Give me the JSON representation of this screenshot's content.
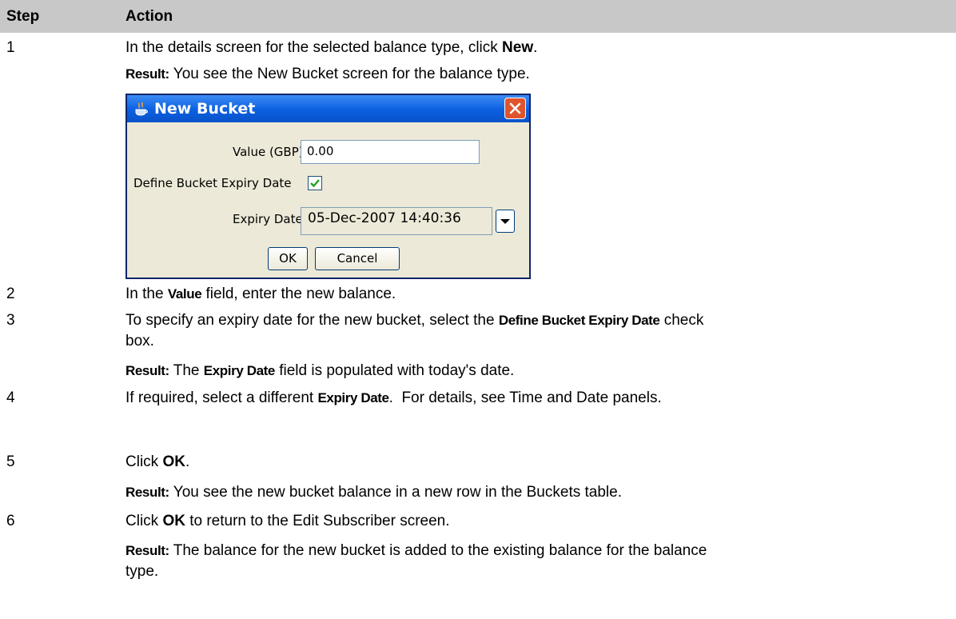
{
  "table": {
    "header": {
      "step": "Step",
      "action": "Action"
    },
    "rows": [
      {
        "num": "1",
        "pre": "In the details screen for the selected balance type, click ",
        "bold": "New",
        "post": ".",
        "result_label": "Result:",
        "result_text": " You see the New Bucket screen for the balance type."
      },
      {
        "num": "2",
        "pre": "In the ",
        "bold": "Value",
        "post": " field, enter the new balance."
      },
      {
        "num": "3",
        "pre": "To specify an expiry date for the new bucket, select the ",
        "bold": "Define Bucket Expiry Date",
        "post": " check",
        "line2": "box.",
        "result_label": "Result:",
        "result_pre": " The ",
        "result_bold": "Expiry Date",
        "result_post": " field is populated with today's date."
      },
      {
        "num": "4",
        "pre": "If required, select a different ",
        "bold": "Expiry Date",
        "post": ".  For details, see Time and Date panels."
      },
      {
        "num": "5",
        "pre": "Click ",
        "bold": "OK",
        "post": ".",
        "result_label": "Result:",
        "result_text": " You see the new bucket balance in a new row in the Buckets table."
      },
      {
        "num": "6",
        "pre": "Click ",
        "bold": "OK",
        "post": " to return to the Edit Subscriber screen.",
        "result_label": "Result:",
        "result_text": " The balance for the new bucket is added to the existing balance for the balance",
        "result_line2": "type."
      }
    ]
  },
  "dialog": {
    "title": "New Bucket",
    "value_label": "Value (GBP)",
    "value": "0.00",
    "define_label": "Define Bucket Expiry Date",
    "define_checked": true,
    "expiry_label": "Expiry Date",
    "expiry_value": "05-Dec-2007 14:40:36",
    "ok_label": "OK",
    "cancel_label": "Cancel"
  }
}
